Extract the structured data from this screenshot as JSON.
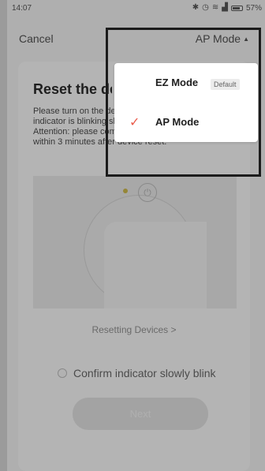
{
  "status_bar": {
    "time": "14:07",
    "battery": "57%",
    "icons": [
      "bluetooth-icon",
      "alarm-icon",
      "wifi-icon",
      "signal-icon",
      "battery-icon"
    ]
  },
  "header": {
    "cancel_label": "Cancel",
    "mode_label": "AP Mode"
  },
  "card": {
    "title": "Reset the device",
    "description": [
      "Please turn on the device and make sure the",
      "indicator is blinking slowly.",
      "Attention: please complete network pairing",
      "within 3 minutes after device reset."
    ]
  },
  "resetting_link": "Resetting Devices >",
  "confirm": {
    "label": "Confirm indicator slowly blink",
    "checked": false
  },
  "next_label": "Next",
  "mode_menu": {
    "items": [
      {
        "label": "EZ Mode",
        "badge": "Default",
        "selected": false
      },
      {
        "label": "AP Mode",
        "badge": "",
        "selected": true
      }
    ]
  },
  "colors": {
    "accent_check": "#ea5b4b",
    "overlay": "rgba(0,0,0,0.26)",
    "led": "#c9b54b"
  }
}
